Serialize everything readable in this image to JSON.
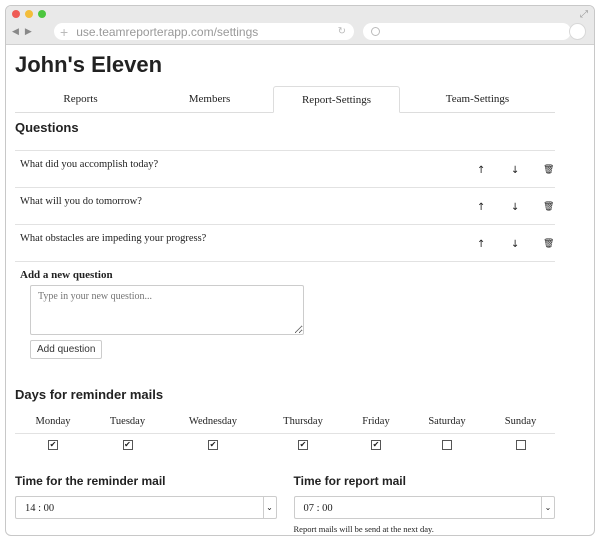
{
  "browser": {
    "url": "use.teamreporterapp.com/settings",
    "back_glyph": "◀",
    "forward_glyph": "▶",
    "plus_glyph": "+",
    "reload_glyph": "↻",
    "search_glyph": "🔍",
    "expand_glyph": "⤢"
  },
  "team": {
    "name": "John's Eleven"
  },
  "tabs": [
    {
      "label": "Reports"
    },
    {
      "label": "Members"
    },
    {
      "label": "Report-Settings",
      "active": true
    },
    {
      "label": "Team-Settings"
    }
  ],
  "questions": {
    "heading": "Questions",
    "items": [
      {
        "text": "What did you accomplish today?"
      },
      {
        "text": "What will you do tomorrow?"
      },
      {
        "text": "What obstacles are impeding your progress?"
      }
    ],
    "icons": {
      "up": "🡑",
      "down": "🡓",
      "delete": "🗑"
    },
    "up_glyph": "↑",
    "down_glyph": "↓",
    "delete_glyph": "🗑"
  },
  "new_question": {
    "label": "Add a new question",
    "placeholder": "Type in your new question...",
    "button_label": "Add question"
  },
  "reminder_days": {
    "heading": "Days for reminder mails",
    "days": [
      {
        "name": "Monday",
        "checked": true
      },
      {
        "name": "Tuesday",
        "checked": true
      },
      {
        "name": "Wednesday",
        "checked": true
      },
      {
        "name": "Thursday",
        "checked": true
      },
      {
        "name": "Friday",
        "checked": true
      },
      {
        "name": "Saturday",
        "checked": false
      },
      {
        "name": "Sunday",
        "checked": false
      }
    ],
    "check_glyph": "✔"
  },
  "reminder_time": {
    "heading": "Time for the reminder mail",
    "value": "14 : 00"
  },
  "report_time": {
    "heading": "Time for report mail",
    "value": "07 : 00",
    "note": "Report mails will be send at the next day."
  },
  "select_arrow_glyph": "⌄"
}
